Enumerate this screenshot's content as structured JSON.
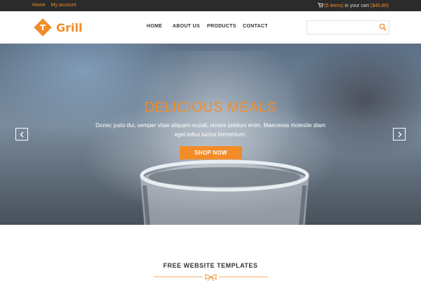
{
  "topbar": {
    "links": [
      "Home",
      "My account"
    ],
    "cart_items": "(5 items)",
    "cart_text": "in your cart",
    "cart_total": "($45.80)"
  },
  "header": {
    "logo_text": "Grill",
    "nav": [
      "HOME",
      "ABOUT US",
      "PRODUCTS",
      "CONTACT"
    ],
    "search_placeholder": ""
  },
  "hero": {
    "title": "DELICIOUS MEALS",
    "text_line1": "Donec justo dui, semper vitae aliquam euzali, ornare pretium enim. Maecenas molestie diam",
    "text_line2": "eget tellus luctus fermentum.",
    "button": "SHOP NOW"
  },
  "section": {
    "title": "FREE WEBSITE TEMPLATES"
  },
  "colors": {
    "accent": "#f28c28",
    "topbar": "#2b2b2b"
  },
  "icons": [
    "cart-icon",
    "logo-icon",
    "search-icon",
    "chevron-left-icon",
    "chevron-right-icon",
    "bow-divider-icon"
  ]
}
